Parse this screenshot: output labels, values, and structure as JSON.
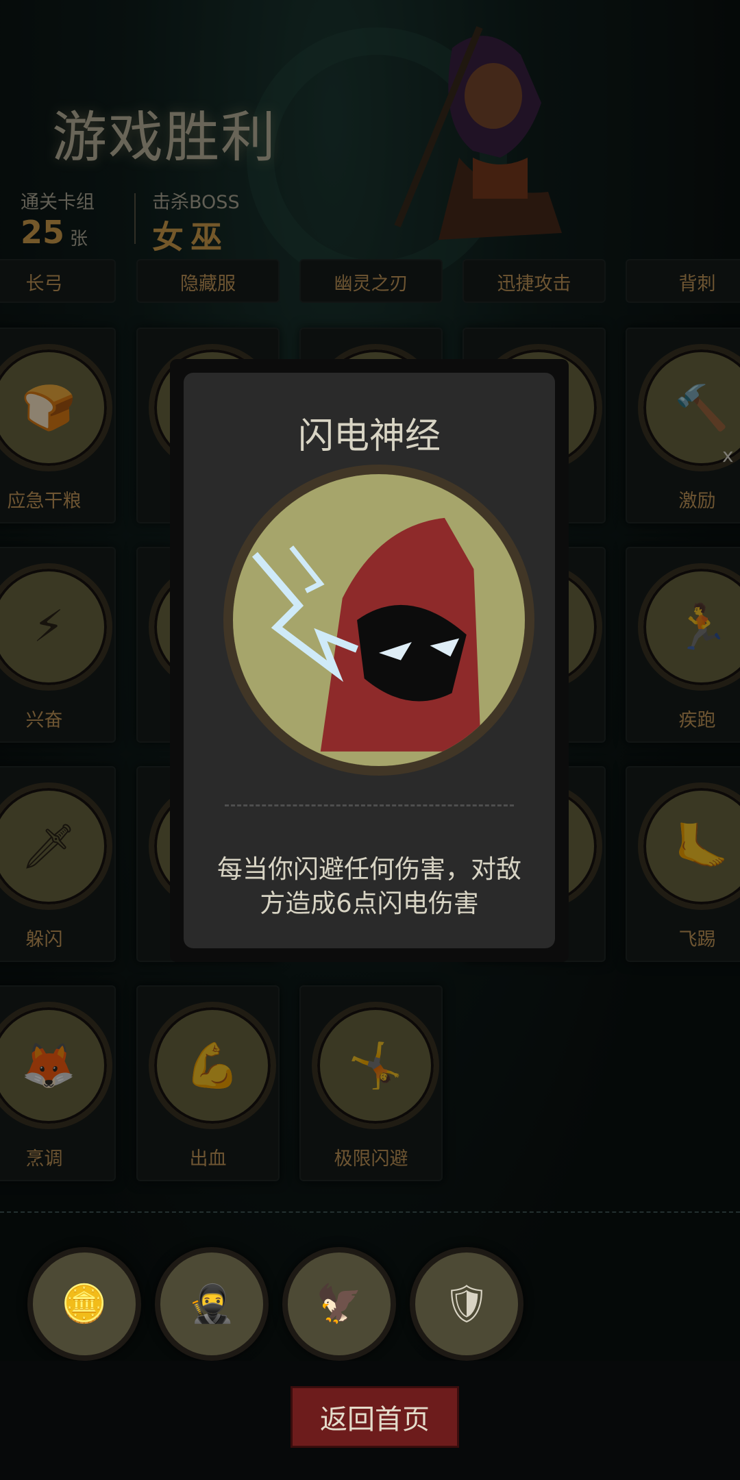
{
  "header": {
    "title": "游戏胜利",
    "cleared_label": "通关卡组",
    "cleared_value": "25",
    "cleared_unit": "张",
    "boss_label": "击杀BOSS",
    "boss_value": "女巫"
  },
  "top_row": [
    "长弓",
    "隐藏服",
    "幽灵之刃",
    "迅捷攻击",
    "背刺"
  ],
  "cards": [
    {
      "label": "应急干粮",
      "icon": "food-icon"
    },
    {
      "label": "激励",
      "icon": "hammer-icon"
    },
    {
      "label": "兴奋",
      "icon": "excited-icon"
    },
    {
      "label": "疾跑",
      "icon": "run-icon"
    },
    {
      "label": "躲闪",
      "icon": "dodge-icon"
    },
    {
      "label": "飞踢",
      "icon": "kick-icon"
    },
    {
      "label": "烹调",
      "icon": "cook-icon"
    },
    {
      "label": "出血",
      "icon": "bleed-icon"
    },
    {
      "label": "极限闪避",
      "icon": "extreme-dodge-icon"
    }
  ],
  "modal": {
    "title": "闪电神经",
    "description": "每当你闪避任何伤害，对敌方造成6点闪电伤害"
  },
  "close_label": "x",
  "tokens": [
    "coin-icon",
    "hooded-icon",
    "eagle-icon",
    "armor-icon"
  ],
  "return_button": "返回首页"
}
